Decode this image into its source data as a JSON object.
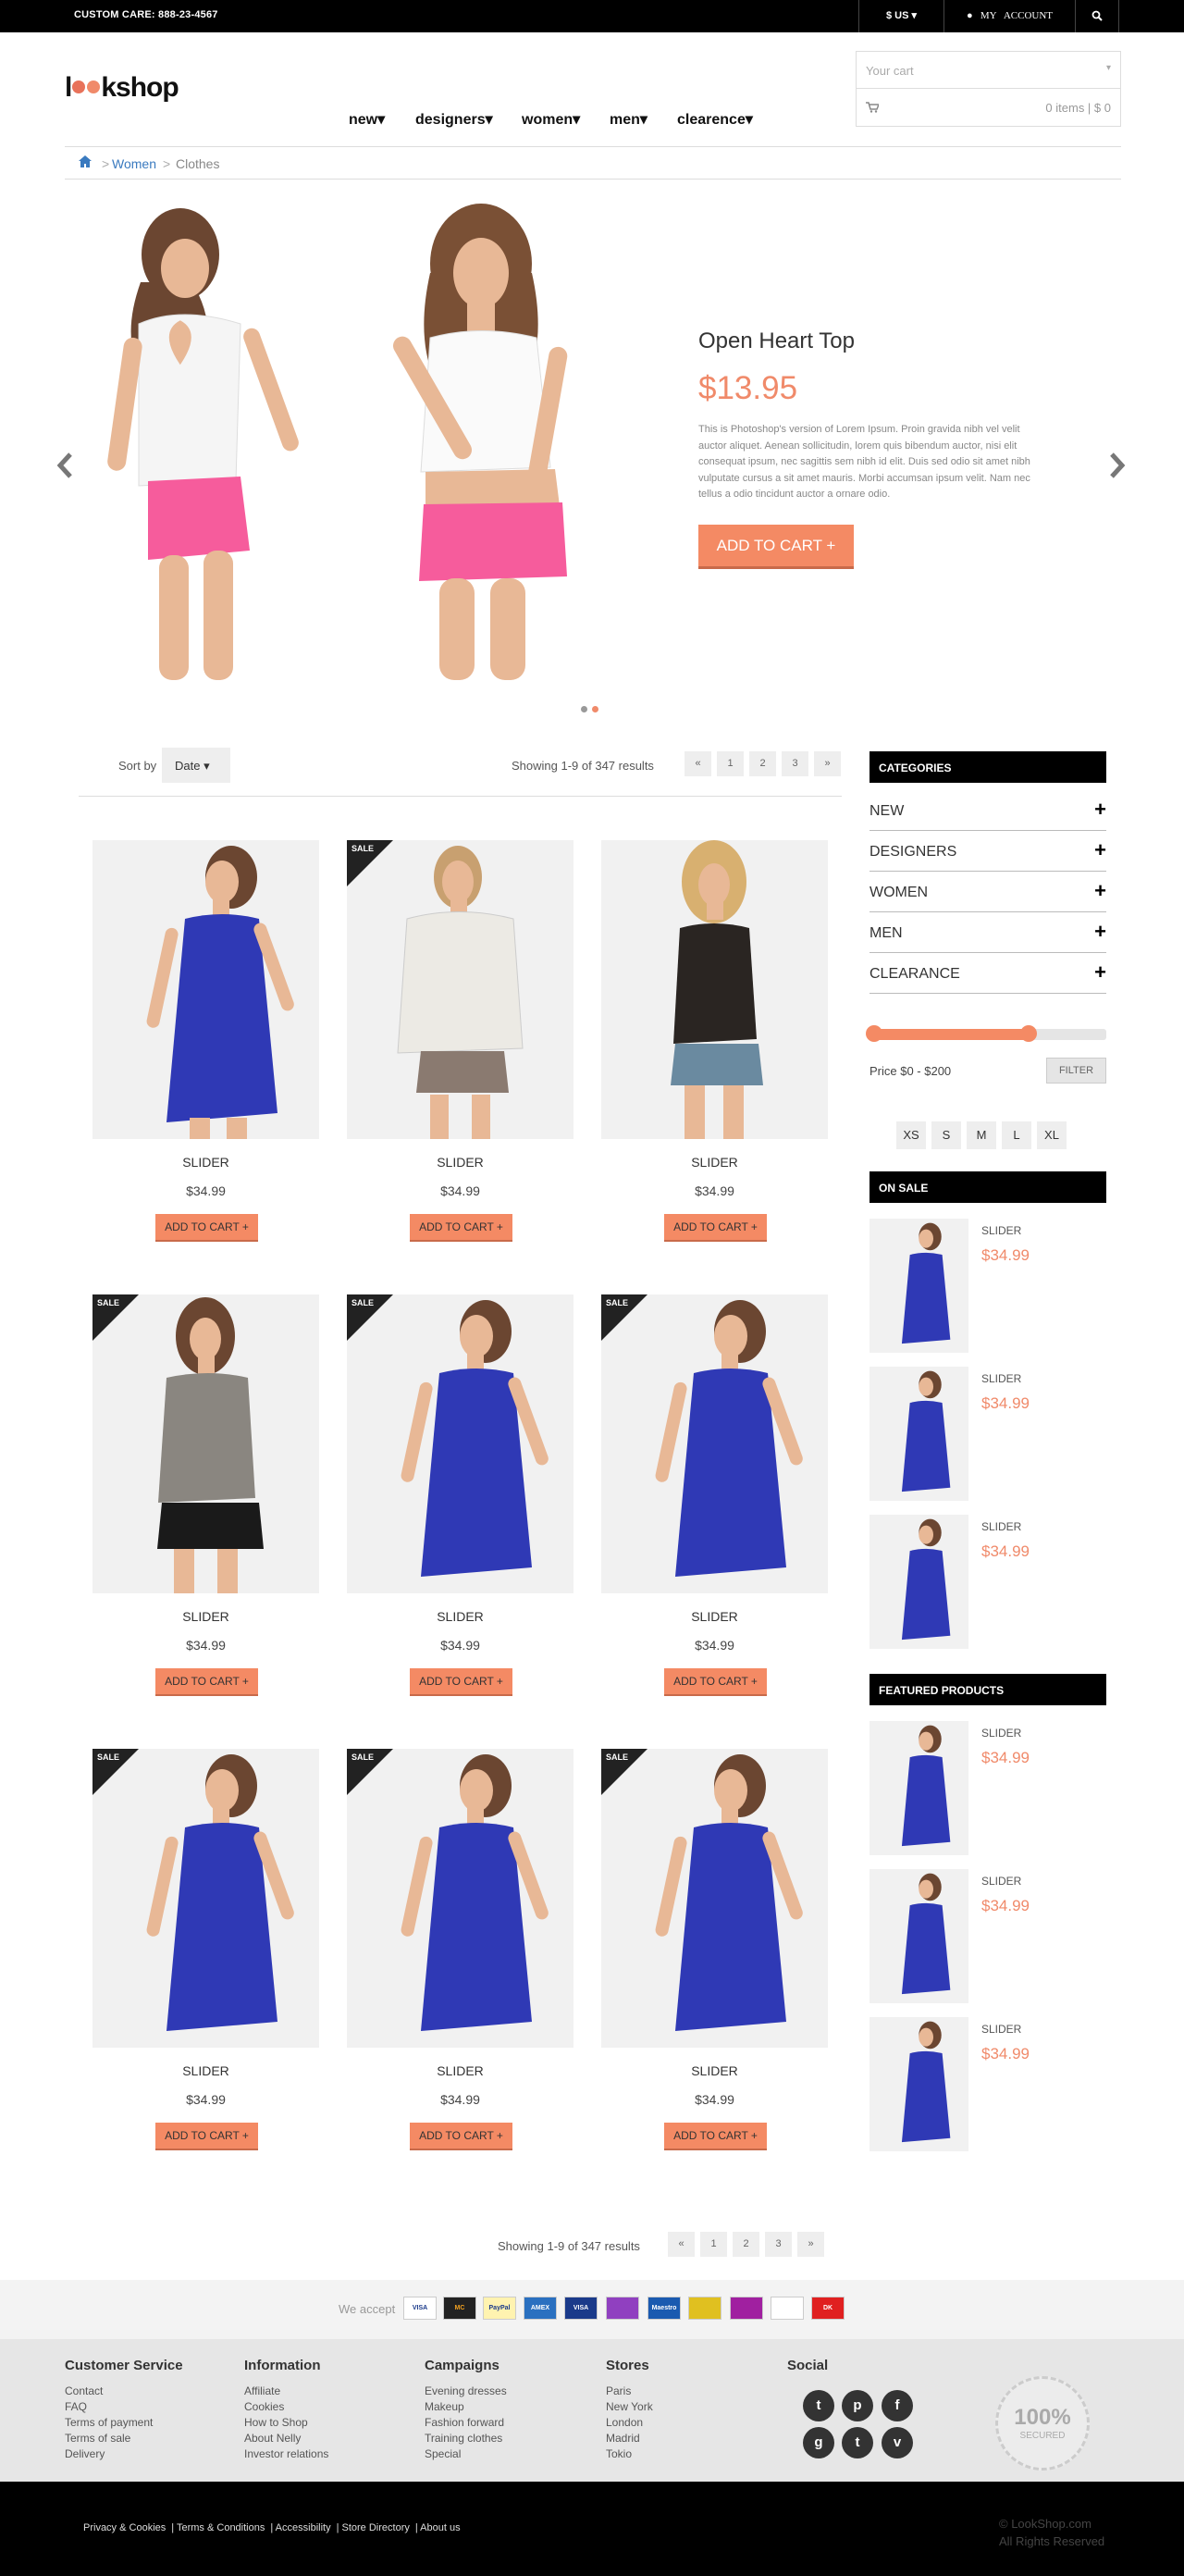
{
  "topbar": {
    "custom_care": "CUSTOM CARE: 888-23-4567",
    "currency": "$ US",
    "account": "MY   ACCOUNT"
  },
  "header": {
    "logo_pre": "l",
    "logo_post": "kshop",
    "nav": [
      "new",
      "designers",
      "women",
      "men",
      "clearence"
    ],
    "cart_placeholder": "Your cart",
    "cart_summary": "0 items | $ 0"
  },
  "breadcrumb": [
    "Women",
    "Clothes"
  ],
  "hero": {
    "title": "Open Heart Top",
    "price": "$13.95",
    "description": "This is Photoshop's version of Lorem Ipsum. Proin gravida nibh vel velit auctor aliquet. Aenean sollicitudin, lorem quis bibendum auctor, nisi elit consequat ipsum, nec sagittis sem nibh id elit. Duis sed odio sit amet nibh vulputate cursus a sit amet mauris. Morbi accumsan ipsum velit. Nam nec tellus a odio tincidunt auctor a ornare odio.",
    "cta": "ADD TO CART +"
  },
  "listing": {
    "sort_label": "Sort by",
    "sort_value": "Date",
    "results": "Showing 1-9 of 347 results",
    "pages": [
      "«",
      "1",
      "2",
      "3",
      "»"
    ]
  },
  "products": [
    {
      "name": "SLIDER",
      "price": "$34.99",
      "cta": "ADD TO CART +",
      "badge": "",
      "dress": "#2f39b5"
    },
    {
      "name": "SLIDER",
      "price": "$34.99",
      "cta": "ADD TO CART +",
      "badge": "SALE",
      "dress": "#eceae4"
    },
    {
      "name": "SLIDER",
      "price": "$34.99",
      "cta": "ADD TO CART +",
      "badge": "",
      "dress": "#2a2522"
    },
    {
      "name": "SLIDER",
      "price": "$34.99",
      "cta": "ADD TO CART +",
      "badge": "SALE",
      "dress": "#8a8680"
    },
    {
      "name": "SLIDER",
      "price": "$34.99",
      "cta": "ADD TO CART +",
      "badge": "SALE",
      "dress": "#2f39b5"
    },
    {
      "name": "SLIDER",
      "price": "$34.99",
      "cta": "ADD TO CART +",
      "badge": "SALE",
      "dress": "#2f39b5"
    },
    {
      "name": "SLIDER",
      "price": "$34.99",
      "cta": "ADD TO CART +",
      "badge": "SALE",
      "dress": "#2f39b5"
    },
    {
      "name": "SLIDER",
      "price": "$34.99",
      "cta": "ADD TO CART +",
      "badge": "SALE",
      "dress": "#2f39b5"
    },
    {
      "name": "SLIDER",
      "price": "$34.99",
      "cta": "ADD TO CART +",
      "badge": "SALE",
      "dress": "#2f39b5"
    }
  ],
  "sidebar": {
    "categories_title": "CATEGORIES",
    "categories": [
      "NEW",
      "DESIGNERS",
      "WOMEN",
      "MEN",
      "CLEARANCE"
    ],
    "price_range": {
      "min": 0,
      "max": 200,
      "low_fraction": 0.0,
      "high_fraction": 0.67
    },
    "price_label": "Price $0 - $200",
    "filter_label": "FILTER",
    "sizes": [
      "XS",
      "S",
      "M",
      "L",
      "XL"
    ],
    "on_sale_title": "ON SALE",
    "on_sale": [
      {
        "name": "SLIDER",
        "price": "$34.99"
      },
      {
        "name": "SLIDER",
        "price": "$34.99"
      },
      {
        "name": "SLIDER",
        "price": "$34.99"
      }
    ],
    "featured_title": "FEATURED PRODUCTS",
    "featured": [
      {
        "name": "SLIDER",
        "price": "$34.99"
      },
      {
        "name": "SLIDER",
        "price": "$34.99"
      },
      {
        "name": "SLIDER",
        "price": "$34.99"
      }
    ]
  },
  "bottom_listing": {
    "results": "Showing 1-9 of 347 results",
    "pages": [
      "«",
      "1",
      "2",
      "3",
      "»"
    ]
  },
  "payments": {
    "label": "We accept",
    "cards": [
      "VISA",
      "MC",
      "PayPal",
      "AMEX",
      "VISA",
      "",
      "Maestro",
      "",
      "",
      "",
      "DK"
    ]
  },
  "footer": {
    "columns": [
      {
        "title": "Customer Service",
        "links": [
          "Contact",
          "FAQ",
          "Terms of payment",
          "Terms of sale",
          "Delivery"
        ]
      },
      {
        "title": "Information",
        "links": [
          "Affiliate",
          "Cookies",
          "How to Shop",
          "About Nelly",
          "Investor relations"
        ]
      },
      {
        "title": "Campaigns",
        "links": [
          "Evening dresses",
          "Makeup",
          "Fashion forward",
          "Training clothes",
          "Special"
        ]
      },
      {
        "title": "Stores",
        "links": [
          "Paris",
          "New York",
          "London",
          "Madrid",
          "Tokio"
        ]
      }
    ],
    "social_title": "Social",
    "secured_big": "100%",
    "secured_small": "SECURED"
  },
  "bottombar": {
    "links": [
      "Privacy & Cookies",
      "Terms & Conditions",
      "Accessibility",
      "Store Directory",
      "About us"
    ],
    "copyright_1": "© LookShop.com",
    "copyright_2": "All Rights Reserved"
  },
  "colors": {
    "accent": "#f48a64",
    "dark": "#000000",
    "link": "#3a7abf"
  }
}
